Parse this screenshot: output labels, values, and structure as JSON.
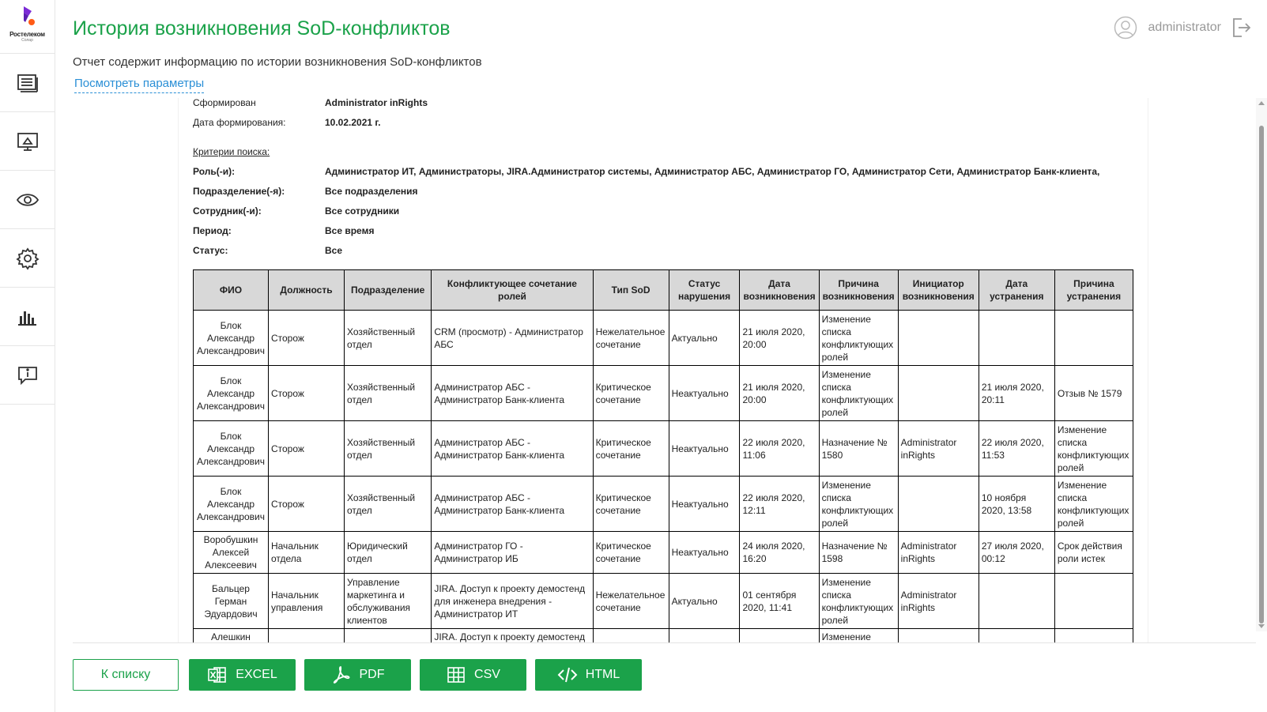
{
  "brand": {
    "name": "Ростелеком",
    "sub": "Солар"
  },
  "header": {
    "title": "История возникновения SoD-конфликтов",
    "subtitle": "Отчет содержит информацию по истории возникновения SoD-конфликтов",
    "params_link": "Посмотреть параметры",
    "user": "administrator"
  },
  "meta": {
    "created_by_label": "Сформирован",
    "created_by": "Administrator inRights",
    "date_label": "Дата формирования:",
    "date": "10.02.2021 г.",
    "criteria_label": "Критерии поиска:",
    "criteria": [
      {
        "label": "Роль(-и):",
        "value": "Администратор ИТ, Администраторы, JIRA.Администратор системы, Администратор АБС, Администратор ГО, Администратор Сети, Администратор Банк-клиента,"
      },
      {
        "label": "Подразделение(-я):",
        "value": "Все подразделения"
      },
      {
        "label": "Сотрудник(-и):",
        "value": "Все сотрудники"
      },
      {
        "label": "Период:",
        "value": "Все время"
      },
      {
        "label": "Статус:",
        "value": "Все"
      }
    ]
  },
  "table": {
    "columns": [
      "ФИО",
      "Должность",
      "Подразделение",
      "Конфликтующее сочетание ролей",
      "Тип SoD",
      "Статус нарушения",
      "Дата возникновения",
      "Причина возникновения",
      "Инициатор возникновения",
      "Дата устранения",
      "Причина устранения"
    ],
    "rows": [
      [
        "Блок Александр Александрович",
        "Сторож",
        "Хозяйственный отдел",
        "CRM (просмотр) - Администратор АБС",
        "Нежелательное сочетание",
        "Актуально",
        "21 июля 2020, 20:00",
        "Изменение списка конфликтующих ролей",
        "",
        "",
        ""
      ],
      [
        "Блок Александр Александрович",
        "Сторож",
        "Хозяйственный отдел",
        "Администратор АБС - Администратор Банк-клиента",
        "Критическое сочетание",
        "Неактуально",
        "21 июля 2020, 20:00",
        "Изменение списка конфликтующих ролей",
        "",
        "21 июля 2020, 20:11",
        "Отзыв № 1579"
      ],
      [
        "Блок Александр Александрович",
        "Сторож",
        "Хозяйственный отдел",
        "Администратор АБС - Администратор Банк-клиента",
        "Критическое сочетание",
        "Неактуально",
        "22 июля 2020, 11:06",
        "Назначение № 1580",
        "Administrator inRights",
        "22 июля 2020, 11:53",
        "Изменение списка конфликтующих ролей"
      ],
      [
        "Блок Александр Александрович",
        "Сторож",
        "Хозяйственный отдел",
        "Администратор АБС - Администратор Банк-клиента",
        "Критическое сочетание",
        "Неактуально",
        "22 июля 2020, 12:11",
        "Изменение списка конфликтующих ролей",
        "",
        "10 ноября 2020, 13:58",
        "Изменение списка конфликтующих ролей"
      ],
      [
        "Воробушкин Алексей Алексеевич",
        "Начальник отдела",
        "Юридический отдел",
        "Администратор ГО - Администратор ИБ",
        "Критическое сочетание",
        "Неактуально",
        "24 июля 2020, 16:20",
        "Назначение № 1598",
        "Administrator inRights",
        "27 июля 2020, 00:12",
        "Срок действия роли истек"
      ],
      [
        "Бальцер Герман Эдуардович",
        "Начальник управления",
        "Управление маркетинга и обслуживания клиентов",
        "JIRA. Доступ к проекту демостенд для инженера внедрения - Администратор ИТ",
        "Нежелательное сочетание",
        "Актуально",
        "01 сентября 2020, 11:41",
        "Изменение списка конфликтующих ролей",
        "Administrator inRights",
        "",
        ""
      ],
      [
        "Алешкин",
        "",
        "",
        "JIRA. Доступ к проекту демостенд",
        "",
        "",
        "",
        "Изменение",
        "",
        "",
        ""
      ]
    ]
  },
  "buttons": {
    "back": "К списку",
    "excel": "EXCEL",
    "pdf": "PDF",
    "csv": "CSV",
    "html": "HTML"
  },
  "colors": {
    "accent": "#1ba24a",
    "link": "#2a8fd6",
    "header_bg": "#d8d8d8"
  },
  "icons": [
    "list-icon",
    "monitor-icon",
    "eye-icon",
    "gear-icon",
    "bar-chart-icon",
    "chat-info-icon",
    "user-avatar-icon",
    "logout-icon",
    "excel-icon",
    "pdf-icon",
    "csv-icon",
    "code-icon"
  ]
}
